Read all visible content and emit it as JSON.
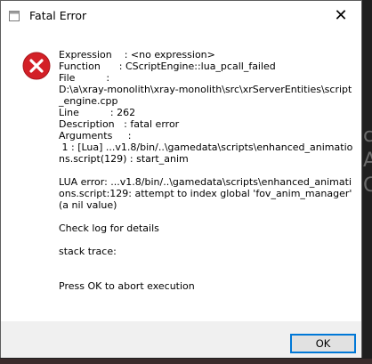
{
  "window": {
    "title": "Fatal Error",
    "close_glyph": "✕",
    "icon": "error-x-icon"
  },
  "message": {
    "lines": [
      "Expression    : <no expression>",
      "Function      : CScriptEngine::lua_pcall_failed",
      "File          :",
      "D:\\a\\xray-monolith\\xray-monolith\\src\\xrServerEntities\\script_engine.cpp",
      "Line          : 262",
      "Description   : fatal error",
      "Arguments     :",
      " 1 : [Lua] ...v1.8/bin/..\\gamedata\\scripts\\enhanced_animations.script(129) : start_anim",
      "",
      "LUA error: ...v1.8/bin/..\\gamedata\\scripts\\enhanced_animations.script:129: attempt to index global 'fov_anim_manager' (a nil value)",
      "",
      "Check log for details",
      "",
      "stack trace:",
      "",
      "",
      "Press OK to abort execution"
    ]
  },
  "footer": {
    "ok_label": "OK"
  },
  "colors": {
    "error_red": "#d32027",
    "button_border": "#0078d7"
  }
}
